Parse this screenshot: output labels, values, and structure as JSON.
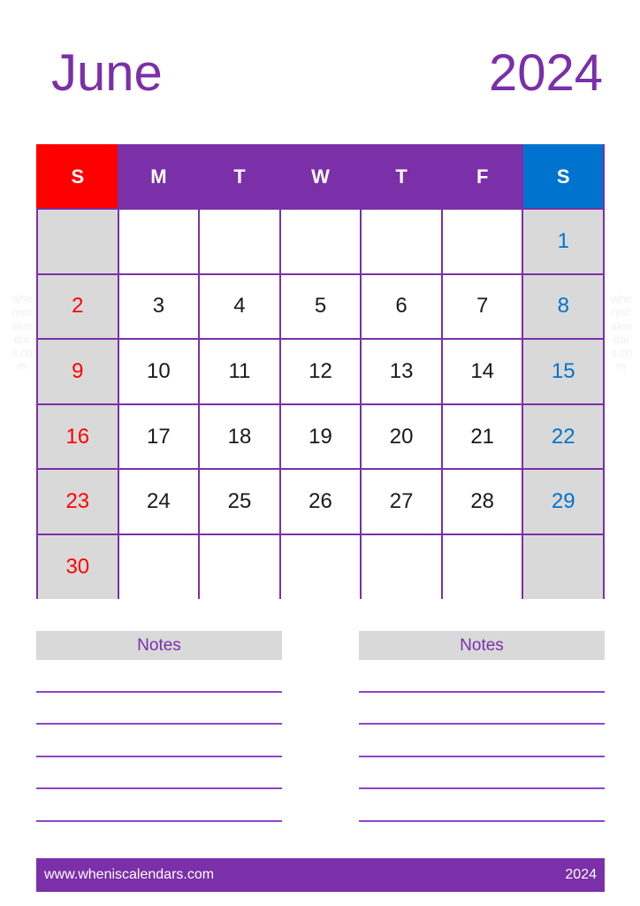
{
  "title": {
    "month": "June",
    "year": "2024"
  },
  "colors": {
    "purple": "#7B2FA8",
    "red": "#FF0000",
    "blue": "#0073CF",
    "gray": "#D9D9D9",
    "line": "#8E44C8"
  },
  "watermark": {
    "text": "wheniscalendars.com"
  },
  "calendar": {
    "weekday_headers": [
      "S",
      "M",
      "T",
      "W",
      "T",
      "F",
      "S"
    ],
    "weeks": [
      [
        "",
        "",
        "",
        "",
        "",
        "",
        "1"
      ],
      [
        "2",
        "3",
        "4",
        "5",
        "6",
        "7",
        "8"
      ],
      [
        "9",
        "10",
        "11",
        "12",
        "13",
        "14",
        "15"
      ],
      [
        "16",
        "17",
        "18",
        "19",
        "20",
        "21",
        "22"
      ],
      [
        "23",
        "24",
        "25",
        "26",
        "27",
        "28",
        "29"
      ],
      [
        "30",
        "",
        "",
        "",
        "",
        "",
        ""
      ]
    ]
  },
  "notes": {
    "left_label": "Notes",
    "right_label": "Notes",
    "line_count": 5
  },
  "footer": {
    "website": "www.wheniscalendars.com",
    "year": "2024"
  }
}
